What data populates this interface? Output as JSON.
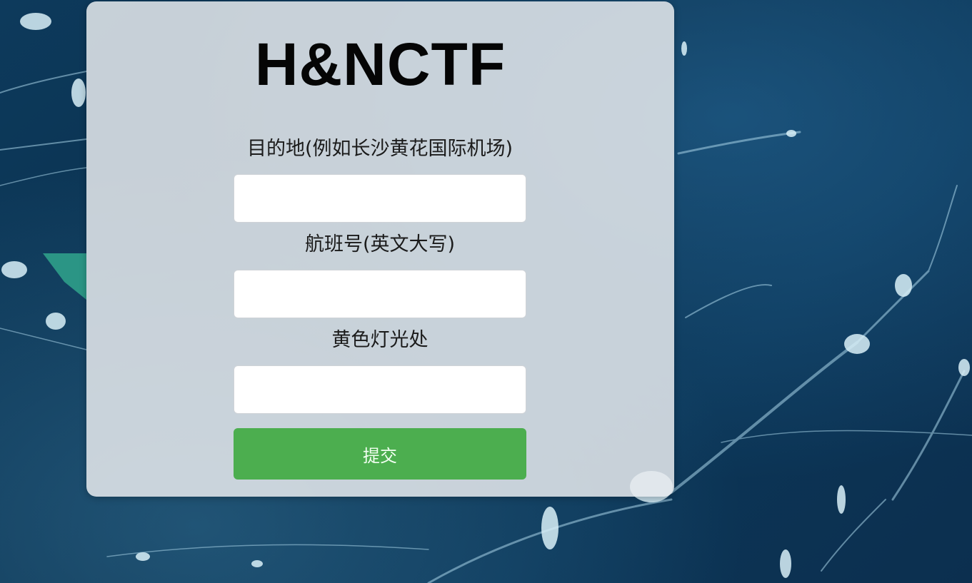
{
  "page": {
    "title": "H&NCTF"
  },
  "form": {
    "fields": [
      {
        "label": "目的地(例如长沙黄花国际机场)",
        "value": "",
        "placeholder": ""
      },
      {
        "label": "航班号(英文大写)",
        "value": "",
        "placeholder": ""
      },
      {
        "label": "黄色灯光处",
        "value": "",
        "placeholder": ""
      }
    ],
    "submit_label": "提交"
  },
  "colors": {
    "background": "#0b3556",
    "card": "#e6eaee",
    "button": "#4cae4f",
    "title": "#050505"
  }
}
